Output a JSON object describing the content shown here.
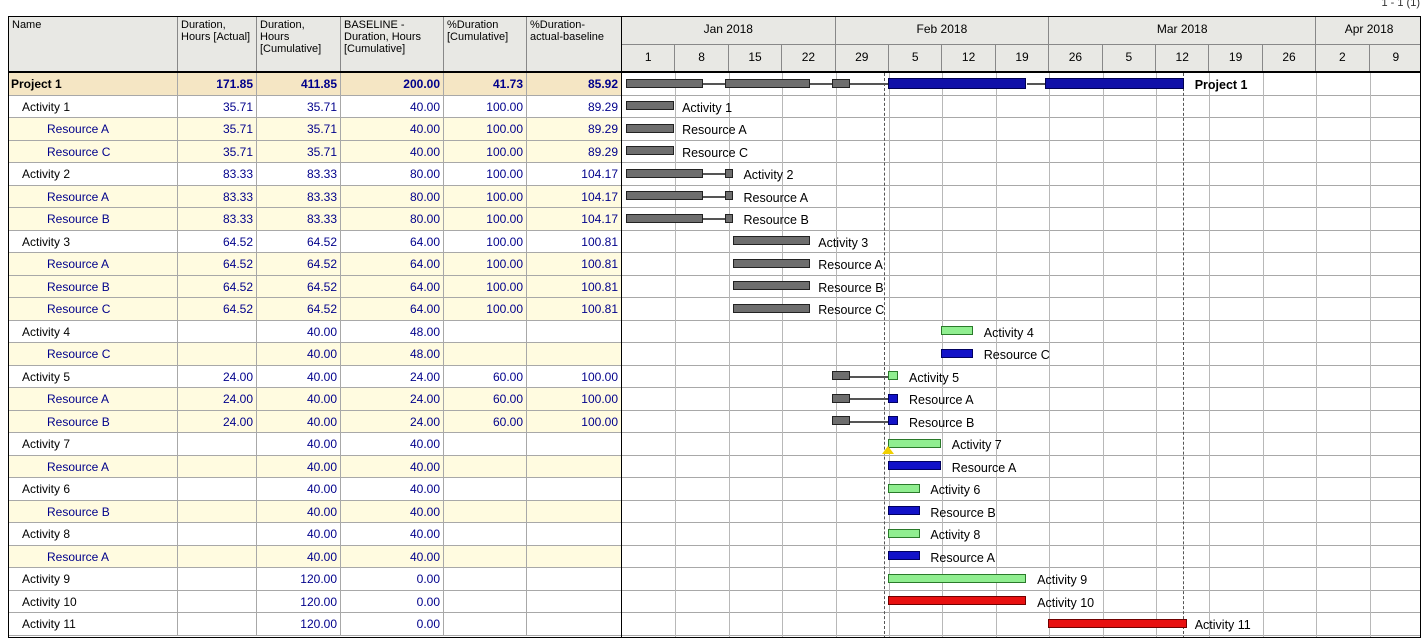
{
  "page_indicator": "1 - 1 (1)",
  "columns": [
    {
      "key": "name",
      "label": "Name"
    },
    {
      "key": "dur_actual",
      "label": "Duration, Hours [Actual]"
    },
    {
      "key": "dur_cum",
      "label": "Duration, Hours [Cumulative]"
    },
    {
      "key": "baseline",
      "label": "BASELINE - Duration, Hours [Cumulative]"
    },
    {
      "key": "pct_cum",
      "label": "%Duration [Cumulative]"
    },
    {
      "key": "pct_ab",
      "label": "%Duration-actual-baseline"
    }
  ],
  "rows": [
    {
      "name": "Project 1",
      "level": 0,
      "type": "proj",
      "dur_actual": "171.85",
      "dur_cum": "411.85",
      "baseline": "200.00",
      "pct_cum": "41.73",
      "pct_ab": "85.92"
    },
    {
      "name": "Activity 1",
      "level": 1,
      "type": "act",
      "dur_actual": "35.71",
      "dur_cum": "35.71",
      "baseline": "40.00",
      "pct_cum": "100.00",
      "pct_ab": "89.29"
    },
    {
      "name": "Resource A",
      "level": 2,
      "type": "res",
      "dur_actual": "35.71",
      "dur_cum": "35.71",
      "baseline": "40.00",
      "pct_cum": "100.00",
      "pct_ab": "89.29"
    },
    {
      "name": "Resource C",
      "level": 2,
      "type": "res",
      "dur_actual": "35.71",
      "dur_cum": "35.71",
      "baseline": "40.00",
      "pct_cum": "100.00",
      "pct_ab": "89.29"
    },
    {
      "name": "Activity 2",
      "level": 1,
      "type": "act",
      "dur_actual": "83.33",
      "dur_cum": "83.33",
      "baseline": "80.00",
      "pct_cum": "100.00",
      "pct_ab": "104.17"
    },
    {
      "name": "Resource A",
      "level": 2,
      "type": "res",
      "dur_actual": "83.33",
      "dur_cum": "83.33",
      "baseline": "80.00",
      "pct_cum": "100.00",
      "pct_ab": "104.17"
    },
    {
      "name": "Resource B",
      "level": 2,
      "type": "res",
      "dur_actual": "83.33",
      "dur_cum": "83.33",
      "baseline": "80.00",
      "pct_cum": "100.00",
      "pct_ab": "104.17"
    },
    {
      "name": "Activity 3",
      "level": 1,
      "type": "act",
      "dur_actual": "64.52",
      "dur_cum": "64.52",
      "baseline": "64.00",
      "pct_cum": "100.00",
      "pct_ab": "100.81"
    },
    {
      "name": "Resource A",
      "level": 2,
      "type": "res",
      "dur_actual": "64.52",
      "dur_cum": "64.52",
      "baseline": "64.00",
      "pct_cum": "100.00",
      "pct_ab": "100.81"
    },
    {
      "name": "Resource B",
      "level": 2,
      "type": "res",
      "dur_actual": "64.52",
      "dur_cum": "64.52",
      "baseline": "64.00",
      "pct_cum": "100.00",
      "pct_ab": "100.81"
    },
    {
      "name": "Resource C",
      "level": 2,
      "type": "res",
      "dur_actual": "64.52",
      "dur_cum": "64.52",
      "baseline": "64.00",
      "pct_cum": "100.00",
      "pct_ab": "100.81"
    },
    {
      "name": "Activity 4",
      "level": 1,
      "type": "act",
      "dur_actual": "",
      "dur_cum": "40.00",
      "baseline": "48.00",
      "pct_cum": "",
      "pct_ab": ""
    },
    {
      "name": "Resource C",
      "level": 2,
      "type": "res",
      "dur_actual": "",
      "dur_cum": "40.00",
      "baseline": "48.00",
      "pct_cum": "",
      "pct_ab": ""
    },
    {
      "name": "Activity 5",
      "level": 1,
      "type": "act",
      "dur_actual": "24.00",
      "dur_cum": "40.00",
      "baseline": "24.00",
      "pct_cum": "60.00",
      "pct_ab": "100.00"
    },
    {
      "name": "Resource A",
      "level": 2,
      "type": "res",
      "dur_actual": "24.00",
      "dur_cum": "40.00",
      "baseline": "24.00",
      "pct_cum": "60.00",
      "pct_ab": "100.00"
    },
    {
      "name": "Resource B",
      "level": 2,
      "type": "res",
      "dur_actual": "24.00",
      "dur_cum": "40.00",
      "baseline": "24.00",
      "pct_cum": "60.00",
      "pct_ab": "100.00"
    },
    {
      "name": "Activity 7",
      "level": 1,
      "type": "act",
      "dur_actual": "",
      "dur_cum": "40.00",
      "baseline": "40.00",
      "pct_cum": "",
      "pct_ab": ""
    },
    {
      "name": "Resource A",
      "level": 2,
      "type": "res",
      "dur_actual": "",
      "dur_cum": "40.00",
      "baseline": "40.00",
      "pct_cum": "",
      "pct_ab": ""
    },
    {
      "name": "Activity 6",
      "level": 1,
      "type": "act",
      "dur_actual": "",
      "dur_cum": "40.00",
      "baseline": "40.00",
      "pct_cum": "",
      "pct_ab": ""
    },
    {
      "name": "Resource B",
      "level": 2,
      "type": "res",
      "dur_actual": "",
      "dur_cum": "40.00",
      "baseline": "40.00",
      "pct_cum": "",
      "pct_ab": ""
    },
    {
      "name": "Activity 8",
      "level": 1,
      "type": "act",
      "dur_actual": "",
      "dur_cum": "40.00",
      "baseline": "40.00",
      "pct_cum": "",
      "pct_ab": ""
    },
    {
      "name": "Resource A",
      "level": 2,
      "type": "res",
      "dur_actual": "",
      "dur_cum": "40.00",
      "baseline": "40.00",
      "pct_cum": "",
      "pct_ab": ""
    },
    {
      "name": "Activity 9",
      "level": 1,
      "type": "act",
      "dur_actual": "",
      "dur_cum": "120.00",
      "baseline": "0.00",
      "pct_cum": "",
      "pct_ab": ""
    },
    {
      "name": "Activity 10",
      "level": 1,
      "type": "act",
      "dur_actual": "",
      "dur_cum": "120.00",
      "baseline": "0.00",
      "pct_cum": "",
      "pct_ab": ""
    },
    {
      "name": "Activity 11",
      "level": 1,
      "type": "act",
      "dur_actual": "",
      "dur_cum": "120.00",
      "baseline": "0.00",
      "pct_cum": "",
      "pct_ab": ""
    }
  ],
  "timeline": {
    "months": [
      "Jan 2018",
      "Feb 2018",
      "Mar 2018",
      "Apr 2018"
    ],
    "days": [
      "1",
      "8",
      "15",
      "22",
      "29",
      "5",
      "12",
      "19",
      "26",
      "5",
      "12",
      "19",
      "26",
      "2",
      "9"
    ],
    "month_span_days": [
      4,
      4,
      5,
      2
    ]
  },
  "gantt_bars": [
    {
      "row": 0,
      "label": "Project 1",
      "bold": true,
      "segments": [
        [
          0,
          1.45,
          "gray"
        ],
        [
          1.85,
          3.45,
          "gray"
        ],
        [
          3.85,
          4.2,
          "gray"
        ],
        [
          4.9,
          7.5,
          "navy"
        ],
        [
          7.85,
          10.45,
          "navy"
        ]
      ],
      "label_at": 10.65
    },
    {
      "row": 1,
      "label": "Activity 1",
      "segments": [
        [
          0,
          0.9,
          "gray"
        ]
      ],
      "label_at": 1.05
    },
    {
      "row": 2,
      "label": "Resource A",
      "segments": [
        [
          0,
          0.9,
          "gray"
        ]
      ],
      "label_at": 1.05
    },
    {
      "row": 3,
      "label": "Resource C",
      "segments": [
        [
          0,
          0.9,
          "gray"
        ]
      ],
      "label_at": 1.05
    },
    {
      "row": 4,
      "label": "Activity 2",
      "segments": [
        [
          0,
          1.45,
          "gray"
        ],
        [
          1.85,
          2.0,
          "gray"
        ]
      ],
      "label_at": 2.2
    },
    {
      "row": 5,
      "label": "Resource A",
      "segments": [
        [
          0,
          1.45,
          "gray"
        ],
        [
          1.85,
          2.0,
          "gray"
        ]
      ],
      "label_at": 2.2
    },
    {
      "row": 6,
      "label": "Resource B",
      "segments": [
        [
          0,
          1.45,
          "gray"
        ],
        [
          1.85,
          2.0,
          "gray"
        ]
      ],
      "label_at": 2.2
    },
    {
      "row": 7,
      "label": "Activity 3",
      "segments": [
        [
          2.0,
          3.45,
          "gray"
        ]
      ],
      "label_at": 3.6
    },
    {
      "row": 8,
      "label": "Resource A",
      "segments": [
        [
          2.0,
          3.45,
          "gray"
        ]
      ],
      "label_at": 3.6
    },
    {
      "row": 9,
      "label": "Resource B",
      "segments": [
        [
          2.0,
          3.45,
          "gray"
        ]
      ],
      "label_at": 3.6
    },
    {
      "row": 10,
      "label": "Resource C",
      "segments": [
        [
          2.0,
          3.45,
          "gray"
        ]
      ],
      "label_at": 3.6
    },
    {
      "row": 11,
      "label": "Activity 4",
      "segments": [
        [
          5.9,
          6.5,
          "green"
        ]
      ],
      "label_at": 6.7
    },
    {
      "row": 12,
      "label": "Resource C",
      "segments": [
        [
          5.9,
          6.5,
          "blue"
        ]
      ],
      "label_at": 6.7
    },
    {
      "row": 13,
      "label": "Activity 5",
      "segments": [
        [
          3.85,
          4.2,
          "gray"
        ],
        [
          4.9,
          5.1,
          "green"
        ]
      ],
      "label_at": 5.3
    },
    {
      "row": 14,
      "label": "Resource A",
      "segments": [
        [
          3.85,
          4.2,
          "gray"
        ],
        [
          4.9,
          5.1,
          "blue"
        ]
      ],
      "label_at": 5.3
    },
    {
      "row": 15,
      "label": "Resource B",
      "segments": [
        [
          3.85,
          4.2,
          "gray"
        ],
        [
          4.9,
          5.1,
          "blue"
        ]
      ],
      "label_at": 5.3
    },
    {
      "row": 16,
      "label": "Activity 7",
      "segments": [
        [
          4.9,
          5.9,
          "green"
        ]
      ],
      "label_at": 6.1,
      "milestone": 4.9
    },
    {
      "row": 17,
      "label": "Resource A",
      "segments": [
        [
          4.9,
          5.9,
          "blue"
        ]
      ],
      "label_at": 6.1
    },
    {
      "row": 18,
      "label": "Activity 6",
      "segments": [
        [
          4.9,
          5.5,
          "green"
        ]
      ],
      "label_at": 5.7
    },
    {
      "row": 19,
      "label": "Resource B",
      "segments": [
        [
          4.9,
          5.5,
          "blue"
        ]
      ],
      "label_at": 5.7
    },
    {
      "row": 20,
      "label": "Activity 8",
      "segments": [
        [
          4.9,
          5.5,
          "green"
        ]
      ],
      "label_at": 5.7
    },
    {
      "row": 21,
      "label": "Resource A",
      "segments": [
        [
          4.9,
          5.5,
          "blue"
        ]
      ],
      "label_at": 5.7
    },
    {
      "row": 22,
      "label": "Activity 9",
      "segments": [
        [
          4.9,
          7.5,
          "green"
        ]
      ],
      "label_at": 7.7
    },
    {
      "row": 23,
      "label": "Activity 10",
      "segments": [
        [
          4.9,
          7.5,
          "red"
        ]
      ],
      "label_at": 7.7
    },
    {
      "row": 24,
      "label": "Activity 11",
      "segments": [
        [
          7.9,
          10.5,
          "red"
        ]
      ],
      "label_at": 10.65
    }
  ],
  "colors": {
    "header_bg": "#e8e8e4",
    "project_row": "#f5e6c4",
    "resource_row": "#fffbe0",
    "numbers": "#00008b",
    "bar_gray": "#6e6e6e",
    "bar_green": "#90ee90",
    "bar_blue": "#1212c8",
    "bar_red": "#e81010"
  }
}
